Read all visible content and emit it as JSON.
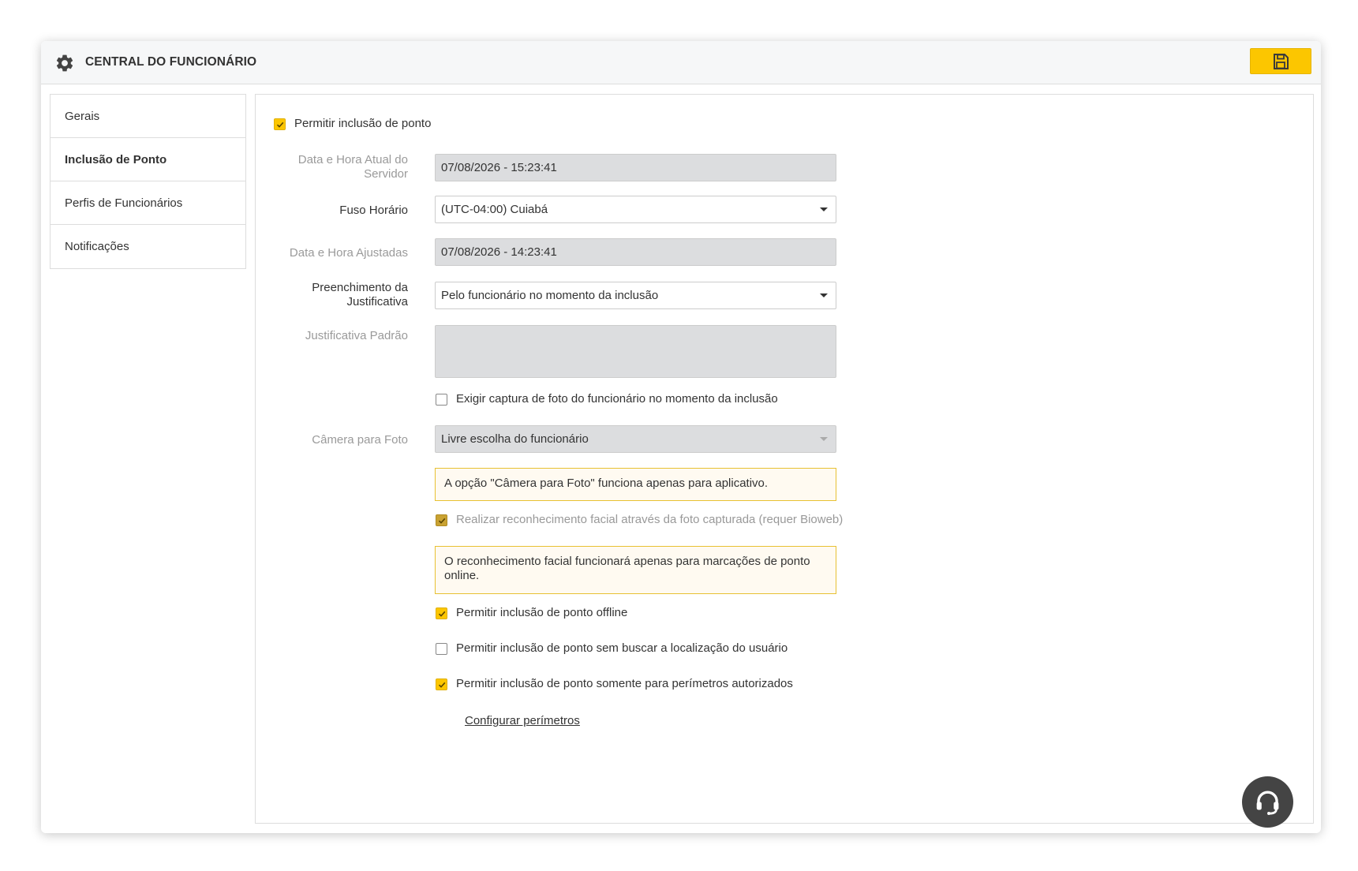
{
  "header": {
    "title": "CENTRAL DO FUNCIONÁRIO",
    "icon": "gear-icon",
    "save_icon": "floppy-disk-icon",
    "accent_color": "#fcc600"
  },
  "sidebar": {
    "items": [
      {
        "label": "Gerais",
        "active": false
      },
      {
        "label": "Inclusão de Ponto",
        "active": true
      },
      {
        "label": "Perfis de Funcionários",
        "active": false
      },
      {
        "label": "Notificações",
        "active": false
      }
    ]
  },
  "form": {
    "allow_inclusion": {
      "label": "Permitir inclusão de ponto",
      "checked": true
    },
    "server_datetime": {
      "label": "Data e Hora Atual do Servidor",
      "value": "07/08/2026 - 15:23:41"
    },
    "timezone": {
      "label": "Fuso Horário",
      "value": "(UTC-04:00) Cuiabá"
    },
    "adjusted_datetime": {
      "label": "Data e Hora Ajustadas",
      "value": "07/08/2026 - 14:23:41"
    },
    "justification_fill": {
      "label": "Preenchimento da Justificativa",
      "value": "Pelo funcionário no momento da inclusão"
    },
    "default_justification": {
      "label": "Justificativa Padrão",
      "value": ""
    },
    "require_photo": {
      "label": "Exigir captura de foto do funcionário no momento da inclusão",
      "checked": false
    },
    "photo_camera": {
      "label": "Câmera para Foto",
      "value": "Livre escolha do funcionário"
    },
    "camera_notice": "A opção \"Câmera para Foto\" funciona apenas para aplicativo.",
    "facial_recognition": {
      "label": "Realizar reconhecimento facial através da foto capturada (requer Bioweb)",
      "checked": true,
      "disabled": true
    },
    "facial_notice": "O reconhecimento facial funcionará apenas para marcações de ponto online.",
    "allow_offline": {
      "label": "Permitir inclusão de ponto offline",
      "checked": true
    },
    "allow_no_location": {
      "label": "Permitir inclusão de ponto sem buscar a localização do usuário",
      "checked": false
    },
    "allow_perimeters": {
      "label": "Permitir inclusão de ponto somente para perímetros autorizados",
      "checked": true
    },
    "configure_perimeters": "Configurar perímetros"
  },
  "help": {
    "icon": "headset-icon"
  }
}
